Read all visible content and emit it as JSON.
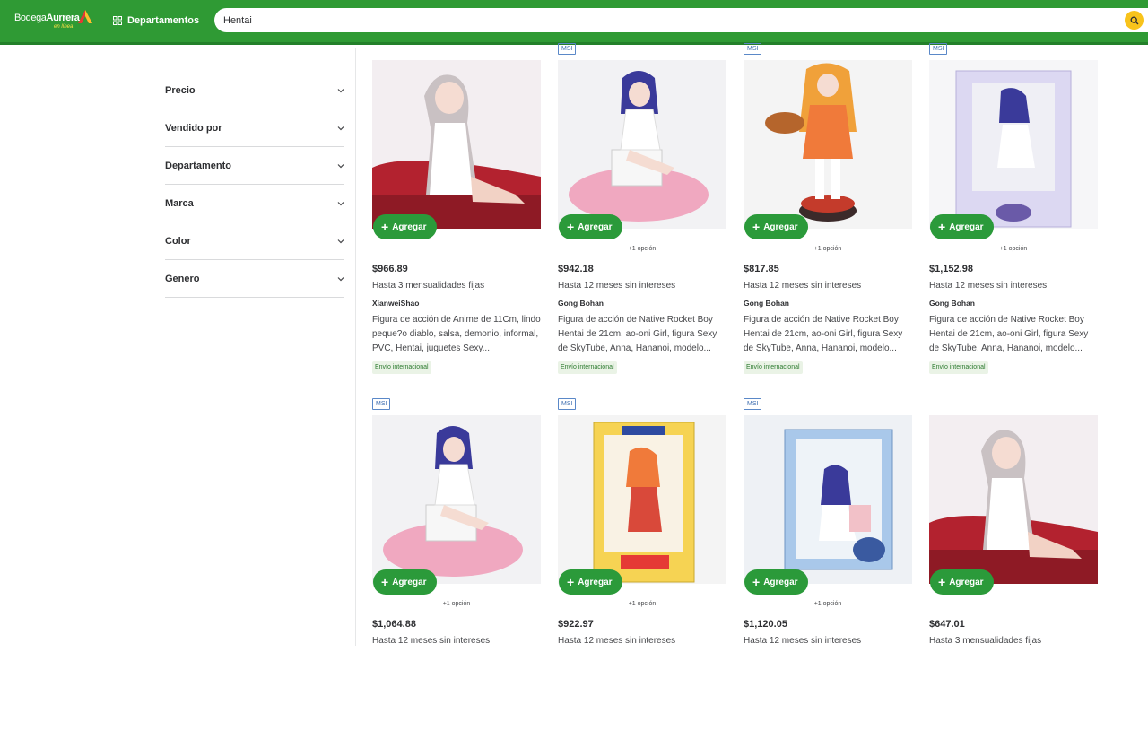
{
  "header": {
    "logo_bodega": "Bodega",
    "logo_aurrera": "Aurrera",
    "logo_sub": "en línea",
    "departments_label": "Departamentos",
    "search_value": "Hentai",
    "colors": {
      "brand_green": "#2f9a34",
      "accent_yellow": "#f8c31b"
    }
  },
  "filters": [
    {
      "label": "Precio"
    },
    {
      "label": "Vendido por"
    },
    {
      "label": "Departamento"
    },
    {
      "label": "Marca"
    },
    {
      "label": "Color"
    },
    {
      "label": "Genero"
    }
  ],
  "products": [
    {
      "msi": "",
      "add": "Agregar",
      "option": "",
      "price": "$966.89",
      "installments": "Hasta 3 mensualidades fijas",
      "seller": "XianweiShao",
      "title": "Figura de acción de Anime de 11Cm, lindo peque?o diablo, salsa, demonio, informal, PVC, Hentai, juguetes Sexy...",
      "shipping": "Envío internacional",
      "image": "white-dress-figure-on-red-sofa"
    },
    {
      "msi": "MSI",
      "add": "Agregar",
      "option": "+1 opción",
      "price": "$942.18",
      "installments": "Hasta 12 meses sin intereses",
      "seller": "Gong Bohan",
      "title": "Figura de acción de Native Rocket Boy Hentai de 21cm, ao-oni Girl, figura Sexy de SkyTube, Anna, Hananoi, modelo...",
      "shipping": "Envío internacional",
      "image": "blue-hair-figure-on-pink-rug"
    },
    {
      "msi": "MSI",
      "add": "Agregar",
      "option": "+1 opción",
      "price": "$817.85",
      "installments": "Hasta 12 meses sin intereses",
      "seller": "Gong Bohan",
      "title": "Figura de acción de Native Rocket Boy Hentai de 21cm, ao-oni Girl, figura Sexy de SkyTube, Anna, Hananoi, modelo...",
      "shipping": "Envío internacional",
      "image": "orange-hair-standing-figure"
    },
    {
      "msi": "MSI",
      "add": "Agregar",
      "option": "+1 opción",
      "price": "$1,152.98",
      "installments": "Hasta 12 meses sin intereses",
      "seller": "Gong Bohan",
      "title": "Figura de acción de Native Rocket Boy Hentai de 21cm, ao-oni Girl, figura Sexy de SkyTube, Anna, Hananoi, modelo...",
      "shipping": "Envío internacional",
      "image": "boxed-figure"
    },
    {
      "msi": "MSI",
      "add": "Agregar",
      "option": "+1 opción",
      "price": "$1,064.88",
      "installments": "Hasta 12 meses sin intereses",
      "seller": "",
      "title": "",
      "shipping": "",
      "image": "blue-hair-figure-on-pink-rug"
    },
    {
      "msi": "MSI",
      "add": "Agregar",
      "option": "+1 opción",
      "price": "$922.97",
      "installments": "Hasta 12 meses sin intereses",
      "seller": "",
      "title": "",
      "shipping": "",
      "image": "yellow-box-figure"
    },
    {
      "msi": "MSI",
      "add": "Agregar",
      "option": "+1 opción",
      "price": "$1,120.05",
      "installments": "Hasta 12 meses sin intereses",
      "seller": "",
      "title": "",
      "shipping": "",
      "image": "blue-box-figure"
    },
    {
      "msi": "",
      "add": "Agregar",
      "option": "",
      "price": "$647.01",
      "installments": "Hasta 3 mensualidades fijas",
      "seller": "",
      "title": "",
      "shipping": "",
      "image": "white-dress-figure-on-red-sofa"
    }
  ]
}
